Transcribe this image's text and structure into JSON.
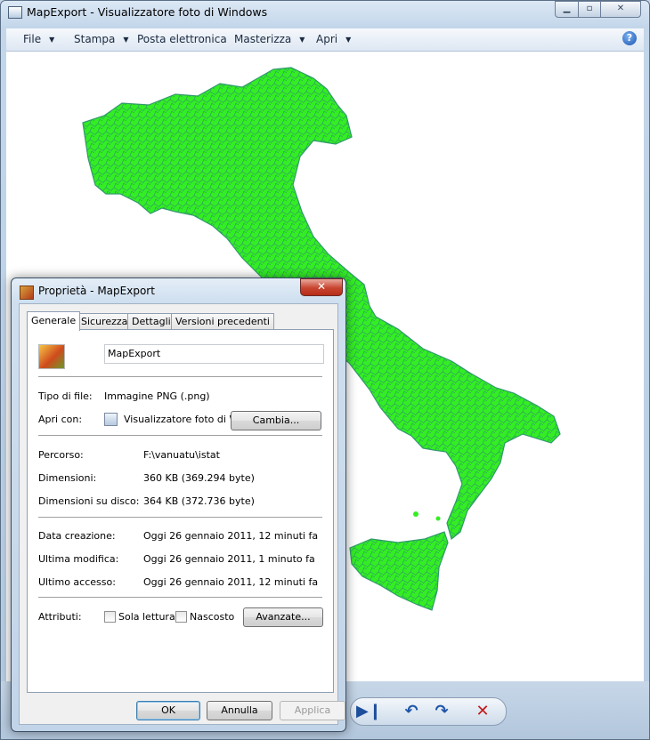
{
  "viewer": {
    "title": "MapExport - Visualizzatore foto di Windows",
    "menu": [
      {
        "label": "File",
        "has_arrow": true
      },
      {
        "label": "Stampa",
        "has_arrow": true
      },
      {
        "label": "Posta elettronica",
        "has_arrow": false
      },
      {
        "label": "Masterizza",
        "has_arrow": true
      },
      {
        "label": "Apri",
        "has_arrow": true
      }
    ],
    "help_icon": "help-icon",
    "map_color": "#33ee22",
    "map_border_color": "#2f9a6a"
  },
  "dialog": {
    "title": "Proprietà - MapExport",
    "tabs": [
      "Generale",
      "Sicurezza",
      "Dettagli",
      "Versioni precedenti"
    ],
    "active_tab": "Generale",
    "file_name": "MapExport",
    "type_label": "Tipo di file:",
    "type_value": "Immagine PNG (.png)",
    "openwith_label": "Apri con:",
    "openwith_value": "Visualizzatore foto di Wi",
    "change_button": "Cambia...",
    "path_label": "Percorso:",
    "path_value": "F:\\vanuatu\\istat",
    "size_label": "Dimensioni:",
    "size_value": "360 KB (369.294 byte)",
    "disk_label": "Dimensioni su disco:",
    "disk_value": "364 KB (372.736 byte)",
    "created_label": "Data creazione:",
    "created_value": "Oggi 26 gennaio 2011, 12 minuti fa",
    "modified_label": "Ultima modifica:",
    "modified_value": "Oggi 26 gennaio 2011, 1 minuto fa",
    "accessed_label": "Ultimo accesso:",
    "accessed_value": "Oggi 26 gennaio 2011, 12 minuti fa",
    "attributes_label": "Attributi:",
    "readonly_label": "Sola lettura",
    "hidden_label": "Nascosto",
    "advanced_button": "Avanzate...",
    "ok_button": "OK",
    "cancel_button": "Annulla",
    "apply_button": "Applica"
  }
}
